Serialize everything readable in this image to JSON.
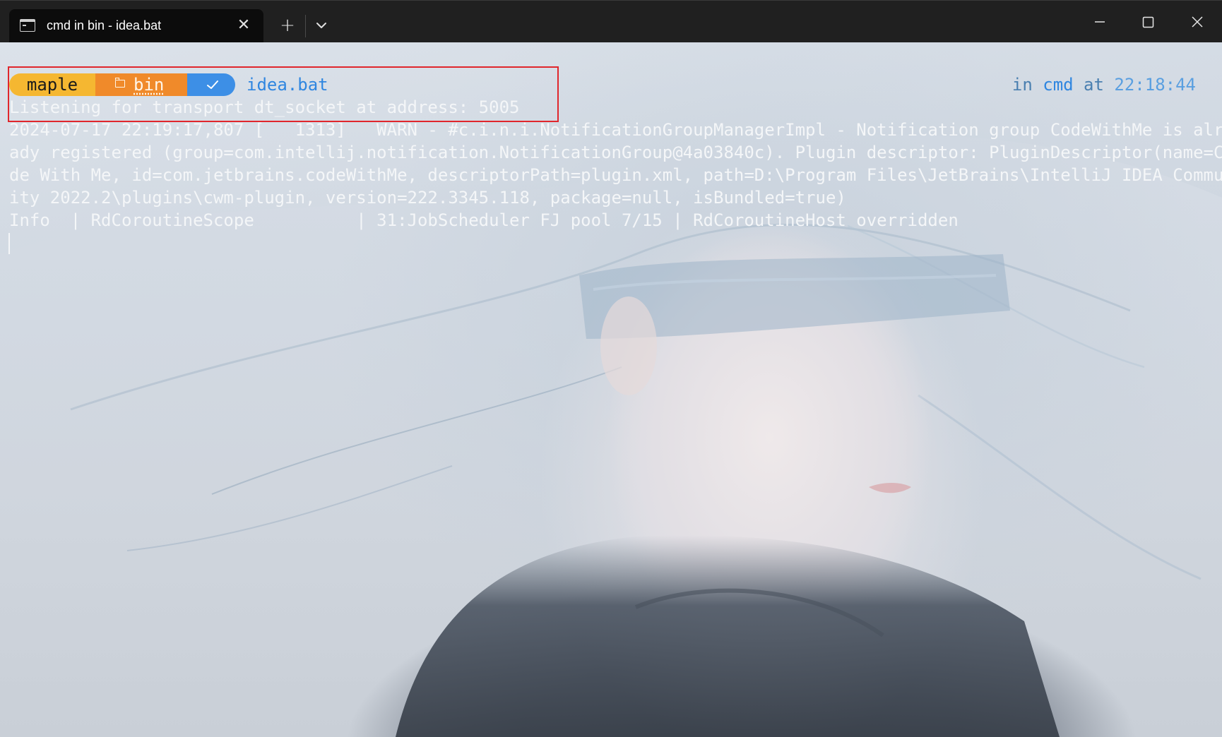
{
  "window": {
    "tab_title": "cmd in bin - idea.bat",
    "close_tab_glyph": "✕",
    "new_tab_glyph": "+"
  },
  "prompt": {
    "user": "maple",
    "directory": "bin",
    "command": "idea.bat",
    "right_prefix": "in ",
    "shell": "cmd",
    "right_mid": " at ",
    "time": "22:18:44"
  },
  "output": {
    "lines": [
      "Listening for transport dt_socket at address: 5005",
      "2024-07-17 22:19:17,807 [   1313]   WARN - #c.i.n.i.NotificationGroupManagerImpl - Notification group CodeWithMe is alre",
      "ady registered (group=com.intellij.notification.NotificationGroup@4a03840c). Plugin descriptor: PluginDescriptor(name=Co",
      "de With Me, id=com.jetbrains.codeWithMe, descriptorPath=plugin.xml, path=D:\\Program Files\\JetBrains\\IntelliJ IDEA Commun",
      "ity 2022.2\\plugins\\cwm-plugin, version=222.3345.118, package=null, isBundled=true)",
      "Info  | RdCoroutineScope          | 31:JobScheduler FJ pool 7/15 | RdCoroutineHost overridden"
    ]
  },
  "colors": {
    "user_segment": "#f5b731",
    "dir_segment": "#f08a2a",
    "status_segment": "#3d8fe6",
    "command_text": "#2f86e0",
    "highlight_box": "#e0262c"
  },
  "icons": {
    "tab_icon": "terminal-icon",
    "close": "close-icon",
    "new_tab": "plus-icon",
    "dropdown": "chevron-down-icon",
    "folder": "folder-icon",
    "status": "check-icon"
  }
}
